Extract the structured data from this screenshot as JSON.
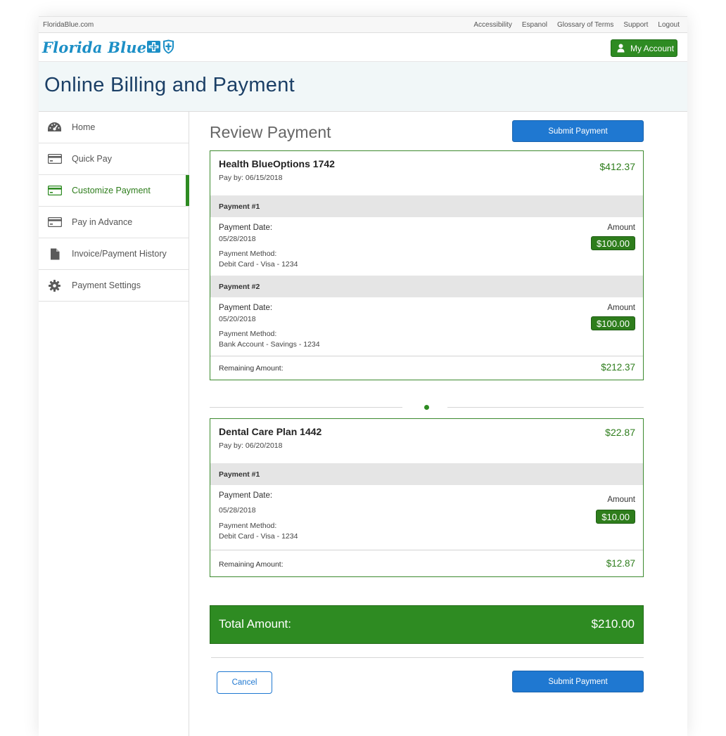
{
  "utility": {
    "site": "FloridaBlue.com",
    "links": [
      "Accessibility",
      "Espanol",
      "Glossary of Terms",
      "Support",
      "Logout"
    ]
  },
  "brand": {
    "logo": "Florida Blue",
    "my_account": "My Account"
  },
  "page": {
    "title": "Online Billing and Payment"
  },
  "sidebar": {
    "items": [
      {
        "label": "Home",
        "icon": "dashboard-icon"
      },
      {
        "label": "Quick Pay",
        "icon": "card-icon"
      },
      {
        "label": "Customize Payment",
        "icon": "card-icon"
      },
      {
        "label": "Pay in Advance",
        "icon": "card-icon"
      },
      {
        "label": "Invoice/Payment History",
        "icon": "document-icon"
      },
      {
        "label": "Payment Settings",
        "icon": "gear-icon"
      }
    ],
    "active_index": 2
  },
  "main": {
    "title": "Review Payment",
    "submit_label": "Submit Payment",
    "cancel_label": "Cancel",
    "plans": [
      {
        "name": "Health BlueOptions 1742",
        "pay_by": "Pay by: 06/15/2018",
        "total": "$412.37",
        "payments": [
          {
            "header": "Payment #1",
            "date_label": "Payment Date:",
            "date": "05/28/2018",
            "method_label": "Payment Method:",
            "method": "Debit Card - Visa - 1234",
            "amount_label": "Amount",
            "amount": "$100.00"
          },
          {
            "header": "Payment #2",
            "date_label": "Payment Date:",
            "date": "05/20/2018",
            "method_label": "Payment Method:",
            "method": "Bank Account - Savings - 1234",
            "amount_label": "Amount",
            "amount": "$100.00"
          }
        ],
        "remaining_label": "Remaining Amount:",
        "remaining": "$212.37"
      },
      {
        "name": "Dental Care Plan 1442",
        "pay_by": "Pay by: 06/20/2018",
        "total": "$22.87",
        "payments": [
          {
            "header": "Payment #1",
            "date_label": "Payment Date:",
            "date": "05/28/2018",
            "method_label": "Payment Method:",
            "method": "Debit Card - Visa - 1234",
            "amount_label": "Amount",
            "amount": "$10.00"
          }
        ],
        "remaining_label": "Remaining Amount:",
        "remaining": "$12.87"
      }
    ],
    "total_label": "Total Amount:",
    "total_value": "$210.00"
  },
  "colors": {
    "brand_green": "#2e8b22",
    "brand_blue": "#1f78d1",
    "title_navy": "#1b3f66",
    "logo_blue": "#1c8fc6"
  }
}
